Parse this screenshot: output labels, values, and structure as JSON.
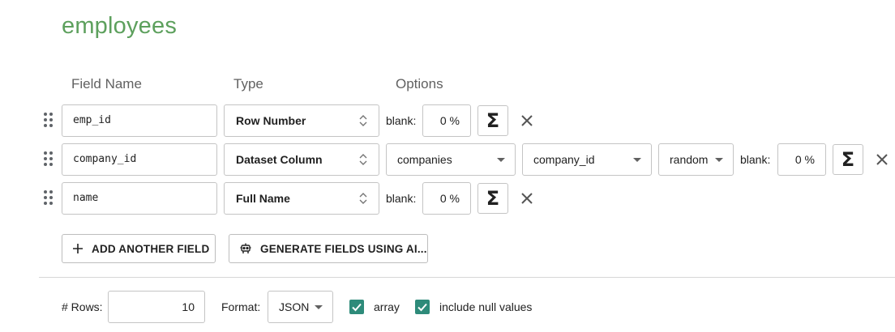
{
  "dataset_title": "employees",
  "headers": {
    "field_name": "Field Name",
    "type": "Type",
    "options": "Options"
  },
  "fields": [
    {
      "name": "emp_id",
      "type": "Row Number",
      "blank_label": "blank:",
      "blank_pct": "0 %"
    },
    {
      "name": "company_id",
      "type": "Dataset Column",
      "dataset": "companies",
      "column": "company_id",
      "selection": "random",
      "blank_label": "blank:",
      "blank_pct": "0 %"
    },
    {
      "name": "name",
      "type": "Full Name",
      "blank_label": "blank:",
      "blank_pct": "0 %"
    }
  ],
  "buttons": {
    "add_field": "ADD ANOTHER FIELD",
    "generate_ai": "GENERATE FIELDS USING AI..."
  },
  "footer": {
    "rows_label": "# Rows:",
    "rows_value": "10",
    "format_label": "Format:",
    "format_value": "JSON",
    "array_label": "array",
    "array_checked": true,
    "include_null_label": "include null values",
    "include_null_checked": true
  },
  "colors": {
    "title": "#5da05d",
    "checkbox": "#2e8b7a"
  },
  "icons": {
    "drag": "drag-handle-icon",
    "sigma": "sigma-icon",
    "close": "close-icon",
    "plus": "plus-icon",
    "robot": "robot-icon",
    "updown": "updown-arrows-icon"
  }
}
